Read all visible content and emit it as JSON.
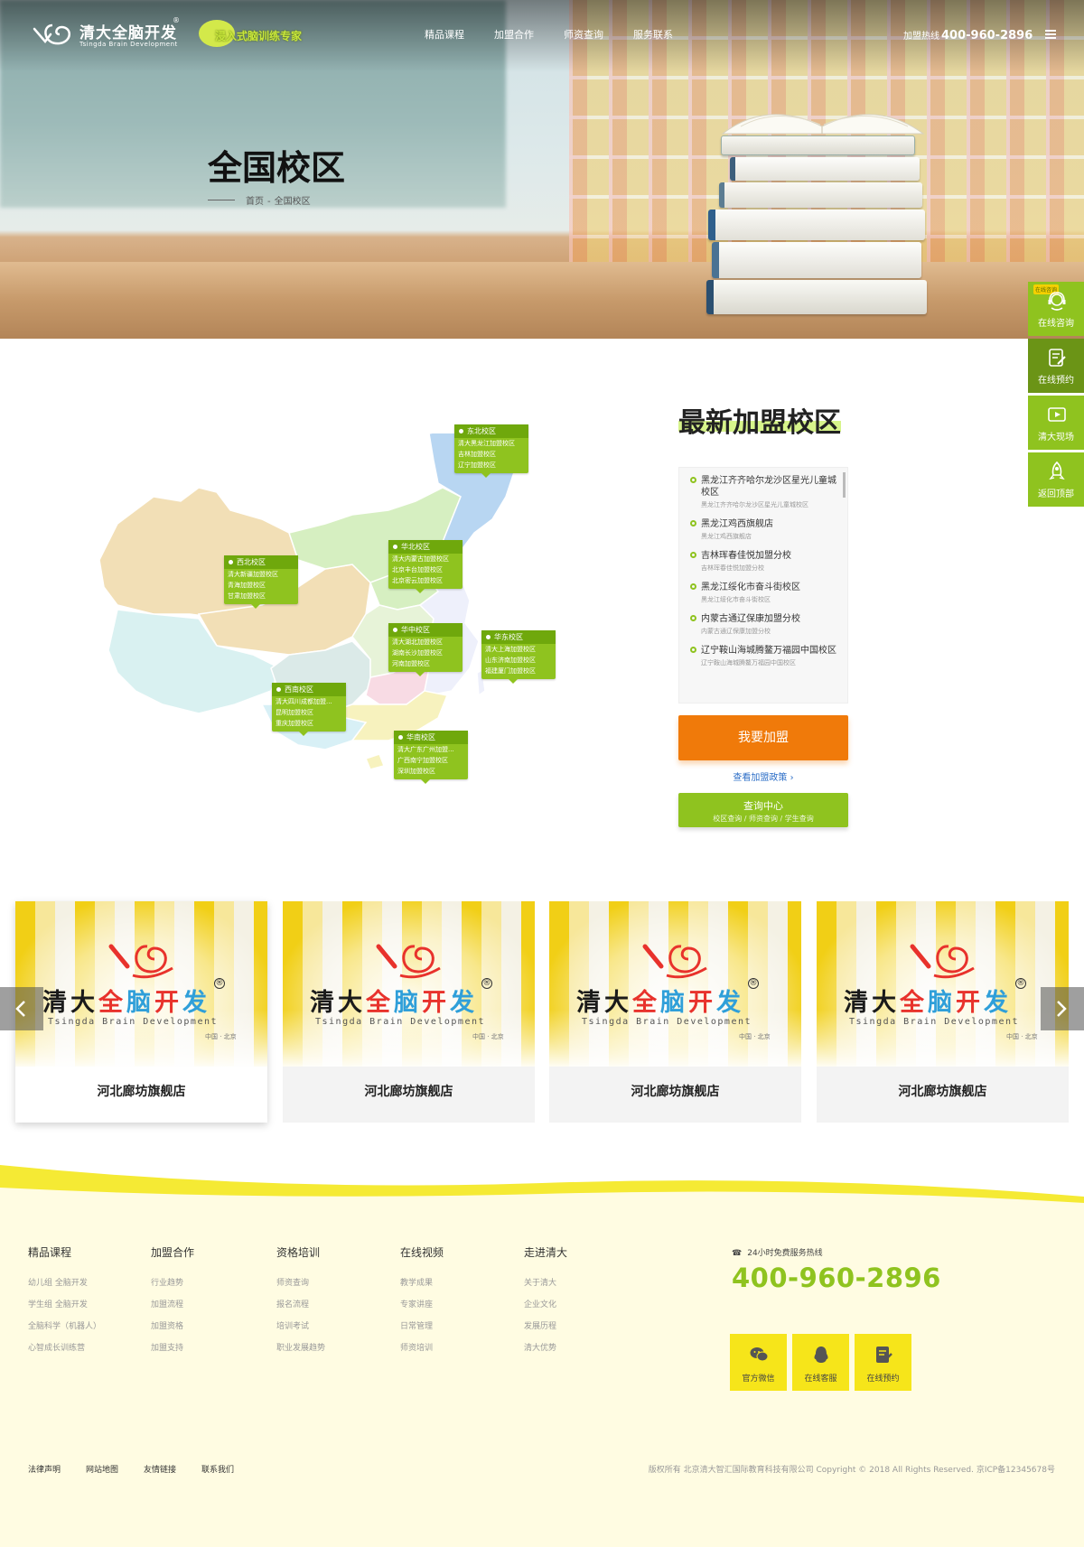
{
  "header": {
    "logo_cn": "清大全脑开发",
    "logo_en": "Tsingda Brain Development",
    "logo_reg": "®",
    "slogan": "浸入式脑训练专家",
    "nav": [
      "精品课程",
      "加盟合作",
      "师资查询",
      "服务联系"
    ],
    "hotline_label": "加盟热线",
    "hotline_number": "400-960-2896",
    "menu_icon": "hamburger-icon"
  },
  "hero": {
    "title": "全国校区",
    "breadcrumb": [
      "首页",
      "-",
      "全国校区"
    ]
  },
  "side_bar": {
    "badge": "在线咨询",
    "items": [
      {
        "label": "在线咨询",
        "icon": "headset-icon"
      },
      {
        "label": "在线预约",
        "icon": "edit-note-icon"
      },
      {
        "label": "清大现场",
        "icon": "video-play-icon"
      },
      {
        "label": "返回顶部",
        "icon": "rocket-icon"
      }
    ]
  },
  "map": {
    "regions": [
      {
        "name": "东北校区",
        "items": [
          "清大黑龙江加盟校区",
          "吉林加盟校区",
          "辽宁加盟校区"
        ]
      },
      {
        "name": "西北校区",
        "items": [
          "清大新疆加盟校区",
          "青海加盟校区",
          "甘肃加盟校区"
        ]
      },
      {
        "name": "华北校区",
        "items": [
          "清大内蒙古加盟校区",
          "北京丰台加盟校区",
          "北京密云加盟校区"
        ]
      },
      {
        "name": "华中校区",
        "items": [
          "清大湖北加盟校区",
          "湖南长沙加盟校区",
          "河南加盟校区"
        ]
      },
      {
        "name": "华东校区",
        "items": [
          "清大上海加盟校区",
          "山东济南加盟校区",
          "福建厦门加盟校区"
        ]
      },
      {
        "name": "西南校区",
        "items": [
          "清大四川成都加盟...",
          "昆明加盟校区",
          "重庆加盟校区"
        ]
      },
      {
        "name": "华南校区",
        "items": [
          "清大广东广州加盟...",
          "广西南宁加盟校区",
          "深圳加盟校区"
        ]
      }
    ],
    "colors": {
      "northwest": "#f2dfb6",
      "west": "#d9f1f1",
      "north": "#d6efc1",
      "northeast": "#b8d6f2",
      "central": "#f8dbe4",
      "east": "#eef0fb",
      "south": "#f7f2be",
      "southwest": "#d8f0f6"
    }
  },
  "latest": {
    "title": "最新加盟校区",
    "items": [
      {
        "title": "黑龙江齐齐哈尔龙沙区星光儿童城校区",
        "sub": "黑龙江齐齐哈尔龙沙区星光儿童城校区"
      },
      {
        "title": "黑龙江鸡西旗舰店",
        "sub": "黑龙江鸡西旗舰店"
      },
      {
        "title": "吉林珲春佳悦加盟分校",
        "sub": "吉林珲春佳悦加盟分校"
      },
      {
        "title": "黑龙江绥化市奋斗街校区",
        "sub": "黑龙江绥化市奋斗街校区"
      },
      {
        "title": "内蒙古通辽保康加盟分校",
        "sub": "内蒙古通辽保康加盟分校"
      },
      {
        "title": "辽宁鞍山海城腾鳌万福园中国校区",
        "sub": "辽宁鞍山海城腾鳌万福园中国校区"
      }
    ],
    "join_button": "我要加盟",
    "policy_link": "查看加盟政策",
    "query_title": "查询中心",
    "query_sub": "校区查询 / 师资查询 / 学生查询"
  },
  "stores": {
    "logo_cn": [
      "清",
      "大",
      "全",
      "脑",
      "开",
      "发"
    ],
    "logo_en": "Tsingda Brain Development",
    "logo_loc": "中国 · 北京",
    "items": [
      {
        "name": "河北廊坊旗舰店"
      },
      {
        "name": "河北廊坊旗舰店"
      },
      {
        "name": "河北廊坊旗舰店"
      },
      {
        "name": "河北廊坊旗舰店"
      }
    ],
    "prev_icon": "chevron-left-icon",
    "next_icon": "chevron-right-icon"
  },
  "footer": {
    "columns": [
      {
        "title": "精品课程",
        "links": [
          "幼儿组 全脑开发",
          "学生组 全脑开发",
          "全脑科学（机器人）",
          "心智成长训练营"
        ]
      },
      {
        "title": "加盟合作",
        "links": [
          "行业趋势",
          "加盟流程",
          "加盟资格",
          "加盟支持"
        ]
      },
      {
        "title": "资格培训",
        "links": [
          "师资查询",
          "报名流程",
          "培训考试",
          "职业发展趋势"
        ]
      },
      {
        "title": "在线视频",
        "links": [
          "教学成果",
          "专家讲座",
          "日常管理",
          "师资培训"
        ]
      },
      {
        "title": "走进清大",
        "links": [
          "关于清大",
          "企业文化",
          "发展历程",
          "清大优势"
        ]
      }
    ],
    "hotline_label": "24小时免费服务热线",
    "hotline": "400-960-2896",
    "icons": [
      {
        "label": "官方微信",
        "icon": "wechat-icon"
      },
      {
        "label": "在线客服",
        "icon": "qq-icon"
      },
      {
        "label": "在线预约",
        "icon": "edit-note-icon"
      }
    ],
    "bottom_links": [
      "法律声明",
      "网站地图",
      "友情链接",
      "联系我们"
    ],
    "copyright": "版权所有 北京清大智汇国际教育科技有限公司 Copyright © 2018 All Rights Reserved.  京ICP备12345678号"
  }
}
